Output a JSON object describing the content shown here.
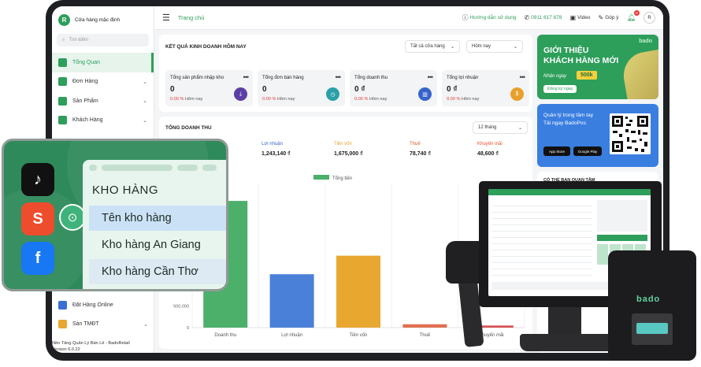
{
  "sidebar": {
    "store_initial": "R",
    "store_name": "Cửa hàng mặc định",
    "search_placeholder": "Tìm kiếm",
    "items": [
      {
        "label": "Tổng Quan"
      },
      {
        "label": "Đơn Hàng"
      },
      {
        "label": "Sản Phẩm"
      },
      {
        "label": "Khách Hàng"
      }
    ],
    "bottom_items": [
      {
        "label": "Đặt Hàng Online"
      },
      {
        "label": "Sàn TMĐT"
      }
    ],
    "version_line1": "Nền Tảng Quản Lý Bán Lẻ - BadoRetail",
    "version_line2": "Version 6.0.22"
  },
  "header": {
    "breadcrumb": "Trang chủ",
    "help": "Hướng dẫn sử dụng",
    "phone": "0911 617 878",
    "video": "Video",
    "feedback": "Góp ý",
    "notif_count": "8",
    "avatar_initial": "R"
  },
  "today": {
    "title": "KẾT QUẢ KINH DOANH HÔM NAY",
    "store_filter": "Tất cả cửa hàng",
    "date_filter": "Hôm nay",
    "kpis": [
      {
        "label": "Tổng sản phẩm nhập kho",
        "value": "0",
        "change": "0.00 %",
        "suffix": "Hôm nay",
        "color": "#5b3fa6"
      },
      {
        "label": "Tổng đơn bán hàng",
        "value": "0",
        "change": "0.00 %",
        "suffix": "Hôm nay",
        "color": "#2aa0a8"
      },
      {
        "label": "Tổng doanh thu",
        "value": "0 ₫",
        "change": "0.00 %",
        "suffix": "Hôm nay",
        "color": "#3563c9"
      },
      {
        "label": "Tổng lợi nhuận",
        "value": "0 ₫",
        "change": "0.00 %",
        "suffix": "Hôm nay",
        "color": "#e8a02a"
      }
    ]
  },
  "revenue": {
    "title": "TỔNG DOANH THU",
    "period": "12 tháng",
    "metrics": [
      {
        "label": "Lợi nhuận",
        "value": "1,243,140 ₫",
        "color": "#3563c9"
      },
      {
        "label": "Tiền vốn",
        "value": "1,675,000 ₫",
        "color": "#e8a02a"
      },
      {
        "label": "Thuế",
        "value": "78,740 ₫",
        "color": "#e8502a"
      },
      {
        "label": "Khuyến mãi",
        "value": "48,600 ₫",
        "color": "#e8502a"
      }
    ]
  },
  "chart_data": {
    "type": "bar",
    "legend": "Tổng tiền",
    "categories": [
      "Doanh thu",
      "Lợi nhuận",
      "Tiền vốn",
      "Thuế",
      "Khuyến mãi"
    ],
    "values": [
      2950000,
      1243140,
      1675000,
      78740,
      48600
    ],
    "colors": [
      "#4caf6a",
      "#4a80d8",
      "#e8a830",
      "#e07050",
      "#d85050"
    ],
    "y_ticks": [
      "500,000",
      "0"
    ],
    "ylim": [
      0,
      3300000
    ]
  },
  "promo": {
    "brand": "bado",
    "headline1": "GIỚI THIỆU",
    "headline2": "KHÁCH HÀNG MỚI",
    "cta_text": "Nhận ngay",
    "amount": "500k",
    "register": "Đăng ký ngay",
    "app_line1": "Quản lý trong tầm tay",
    "app_line2": "Tải ngay BadoPos",
    "app_store": "App Store",
    "google_play": "Google Play"
  },
  "suggest_title": "CÓ THỂ BẠN QUAN TÂM",
  "warehouse": {
    "title": "KHO HÀNG",
    "rows": [
      "Tên kho hàng",
      "Kho hàng An Giang",
      "Kho hàng Cần Thơ"
    ]
  },
  "apps": [
    {
      "name": "tiktok-icon",
      "glyph": "♪",
      "color": "#111111"
    },
    {
      "name": "shopee-icon",
      "glyph": "S",
      "color": "#ee4d2d"
    },
    {
      "name": "facebook-icon",
      "glyph": "f",
      "color": "#1877f2"
    }
  ],
  "device_brand": "bado"
}
